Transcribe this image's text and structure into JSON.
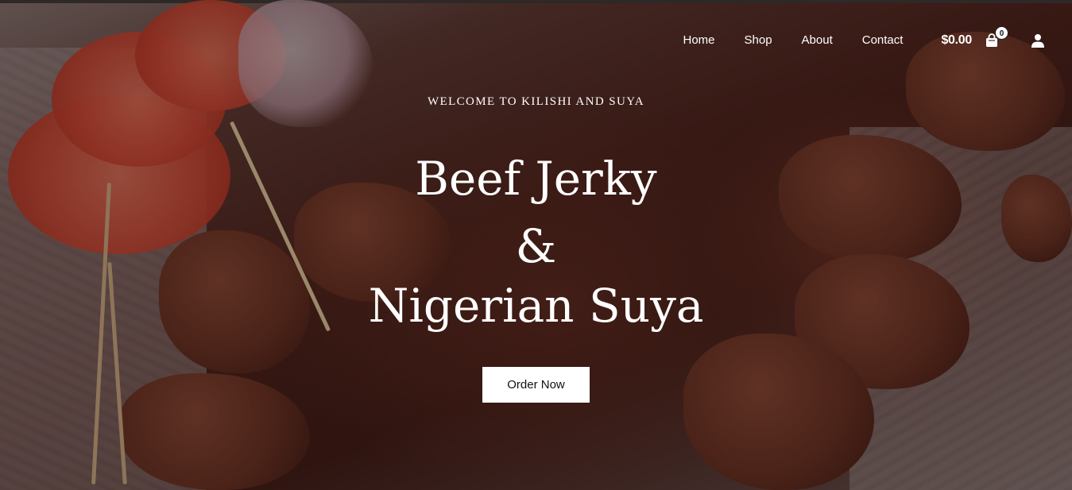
{
  "nav": {
    "links": [
      "Home",
      "Shop",
      "About",
      "Contact"
    ],
    "cart_total": "$0.00",
    "cart_count": "0",
    "icons": {
      "cart": "shopping-bag-icon",
      "account": "user-icon"
    }
  },
  "hero": {
    "welcome": "WELCOME TO KILISHI AND SUYA",
    "title_line1": "Beef Jerky",
    "title_line2": "&",
    "title_line3": "Nigerian Suya",
    "cta_label": "Order Now"
  },
  "colors": {
    "text": "#ffffff",
    "button_bg": "#ffffff",
    "button_text": "#111111"
  }
}
